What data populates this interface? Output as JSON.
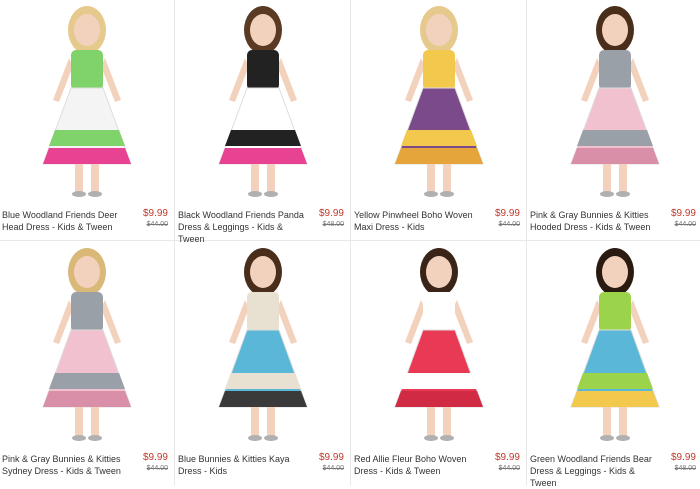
{
  "products": [
    {
      "name": "Blue Woodland Friends Deer Head Dress - Kids & Tween",
      "price": "$9.99",
      "old_price": "$44.00",
      "icon": "girl-in-white-tiered-dress-photo",
      "colors": {
        "dress": "#f4f4f4",
        "accent": "#7fd36a",
        "accent2": "#e84393",
        "hair": "#e6c98c"
      }
    },
    {
      "name": "Black Woodland Friends Panda Dress & Leggings - Kids & Tween",
      "price": "$9.99",
      "old_price": "$48.00",
      "icon": "girl-in-panda-dress-photo",
      "colors": {
        "dress": "#ffffff",
        "accent": "#222222",
        "accent2": "#e84393",
        "hair": "#5a3a22"
      }
    },
    {
      "name": "Yellow Pinwheel Boho Woven Maxi Dress - Kids",
      "price": "$9.99",
      "old_price": "$44.00",
      "icon": "girl-in-yellow-maxi-dress-photo",
      "colors": {
        "dress": "#7a4a8a",
        "accent": "#f2c94c",
        "accent2": "#e6a53a",
        "hair": "#e6c98c"
      }
    },
    {
      "name": "Pink & Gray Bunnies & Kitties Hooded Dress - Kids & Tween",
      "price": "$9.99",
      "old_price": "$44.00",
      "icon": "girl-in-pink-bunny-dress-photo",
      "colors": {
        "dress": "#f2c1cf",
        "accent": "#9aa0a8",
        "accent2": "#d98fa8",
        "hair": "#4a2e1c"
      }
    },
    {
      "name": "Pink & Gray Bunnies & Kitties Sydney Dress - Kids & Tween",
      "price": "$9.99",
      "old_price": "$44.00",
      "icon": "girl-in-pink-sydney-dress-photo",
      "colors": {
        "dress": "#f2c1cf",
        "accent": "#9aa0a8",
        "accent2": "#d98fa8",
        "hair": "#d9b878"
      }
    },
    {
      "name": "Blue Bunnies & Kitties Kaya Dress - Kids",
      "price": "$9.99",
      "old_price": "$44.00",
      "icon": "girl-in-blue-kaya-dress-photo",
      "colors": {
        "dress": "#5ab7d8",
        "accent": "#e8e0d0",
        "accent2": "#3a3a3a",
        "hair": "#4a2e1c"
      }
    },
    {
      "name": "Red Allie Fleur Boho Woven Dress - Kids & Tween",
      "price": "$9.99",
      "old_price": "$44.00",
      "icon": "girl-in-red-boho-dress-photo",
      "colors": {
        "dress": "#e83a55",
        "accent": "#ffffff",
        "accent2": "#d12a45",
        "hair": "#3a2418"
      }
    },
    {
      "name": "Green Woodland Friends Bear Dress & Leggings - Kids & Tween",
      "price": "$9.99",
      "old_price": "$48.00",
      "icon": "girl-in-green-bear-dress-photo",
      "colors": {
        "dress": "#5ab7d8",
        "accent": "#9bd34a",
        "accent2": "#f2c94c",
        "hair": "#2a1a10"
      }
    }
  ]
}
